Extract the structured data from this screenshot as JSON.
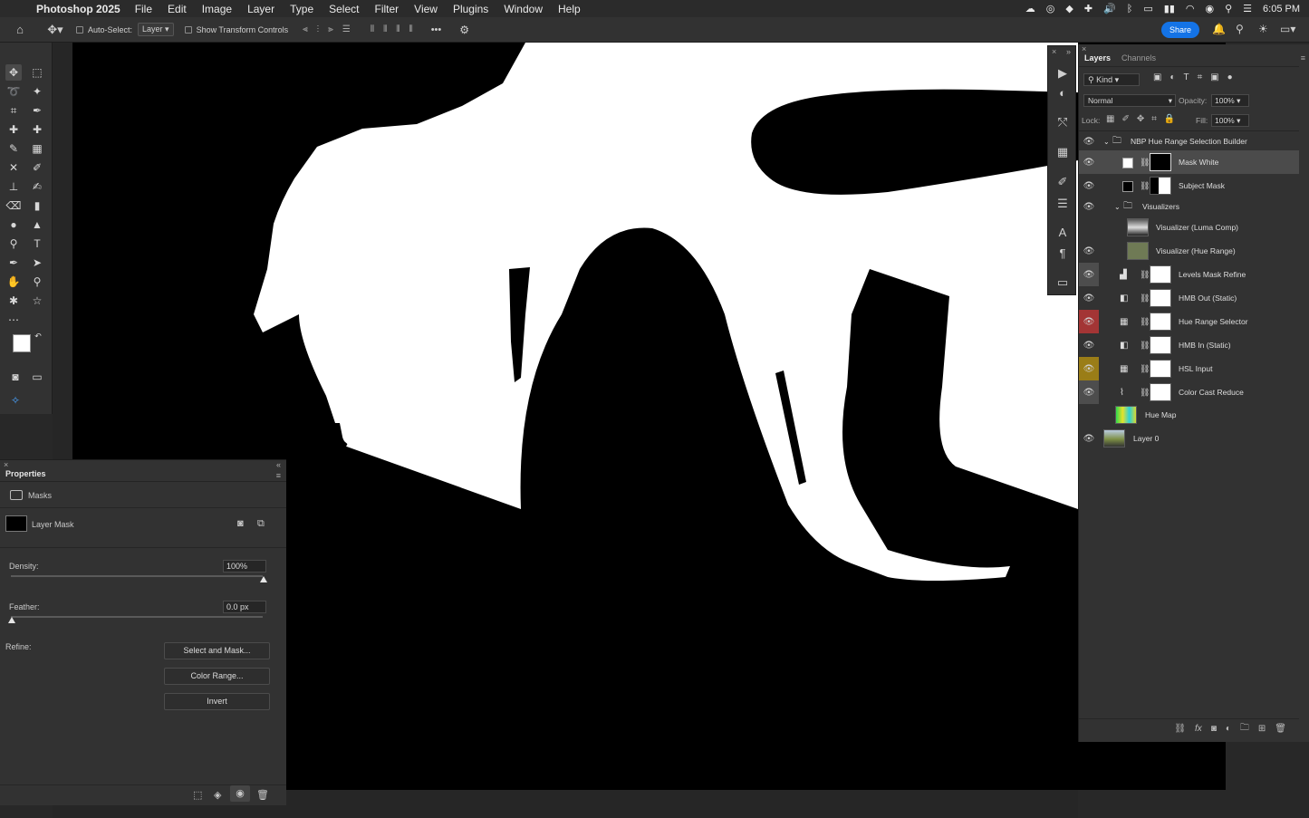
{
  "menubar": {
    "app_name": "Photoshop 2025",
    "items": [
      "File",
      "Edit",
      "Image",
      "Layer",
      "Type",
      "Select",
      "Filter",
      "View",
      "Plugins",
      "Window",
      "Help"
    ],
    "clock": "6:05 PM"
  },
  "options_bar": {
    "auto_select_label": "Auto-Select:",
    "auto_select_target": "Layer",
    "show_transform_label": "Show Transform Controls",
    "more_label": "•••",
    "share_label": "Share"
  },
  "properties": {
    "title": "Properties",
    "section": "Masks",
    "mask_type": "Layer Mask",
    "density_label": "Density:",
    "density_value": "100%",
    "feather_label": "Feather:",
    "feather_value": "0.0 px",
    "refine_label": "Refine:",
    "select_and_mask_label": "Select and Mask...",
    "color_range_label": "Color Range...",
    "invert_label": "Invert"
  },
  "layers_panel": {
    "tabs": [
      "Layers",
      "Channels"
    ],
    "filter_kind": "Kind",
    "blend_mode": "Normal",
    "opacity_label": "Opacity:",
    "opacity_value": "100%",
    "lock_label": "Lock:",
    "fill_label": "Fill:",
    "fill_value": "100%",
    "layers": [
      {
        "name": "NBP Hue Range Selection Builder",
        "type": "group",
        "visible": true
      },
      {
        "name": "Mask White",
        "type": "fill",
        "visible": true,
        "selected": true
      },
      {
        "name": "Subject Mask",
        "type": "fill",
        "visible": true
      },
      {
        "name": "Visualizers",
        "type": "group",
        "visible": true
      },
      {
        "name": "Visualizer (Luma Comp)",
        "type": "pixel",
        "visible": false
      },
      {
        "name": "Visualizer (Hue Range)",
        "type": "pixel",
        "visible": true
      },
      {
        "name": "Levels Mask Refine",
        "type": "adjustment",
        "visible": true
      },
      {
        "name": "HMB Out (Static)",
        "type": "adjustment",
        "visible": true
      },
      {
        "name": "Hue Range Selector",
        "type": "adjustment",
        "visible": true,
        "color_tag": "#a33535"
      },
      {
        "name": "HMB In (Static)",
        "type": "adjustment",
        "visible": true
      },
      {
        "name": "HSL Input",
        "type": "adjustment",
        "visible": true,
        "color_tag": "#9a7d17"
      },
      {
        "name": "Color Cast Reduce",
        "type": "adjustment",
        "visible": true
      },
      {
        "name": "Hue Map",
        "type": "pixel",
        "visible": false
      },
      {
        "name": "Layer 0",
        "type": "pixel",
        "visible": true
      }
    ]
  },
  "colors": {
    "accent": "#1473e6",
    "panel": "#323232",
    "selected_row": "#4b4b4b"
  }
}
